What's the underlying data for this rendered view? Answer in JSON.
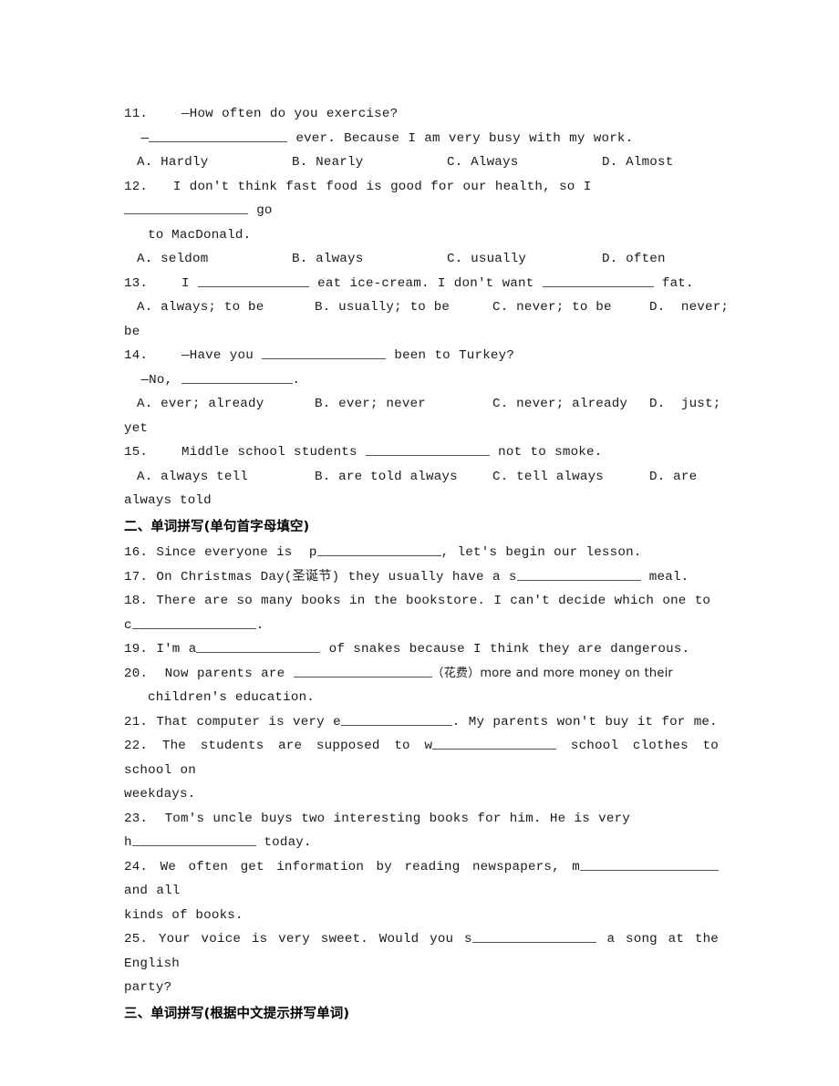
{
  "document": {
    "type": "english-exercise-worksheet",
    "page_background": "#ffffff",
    "text_color": "#1a1a1a"
  },
  "multiple_choice": {
    "questions": [
      {
        "number": "11.",
        "stem_line1": "—How often do you exercise?",
        "stem_line2_pre": "—",
        "stem_line2_post": " ever. Because I am very busy with my work.",
        "options": [
          "A. Hardly",
          "B. Nearly",
          "C. Always",
          "D. Almost"
        ]
      },
      {
        "number": "12.",
        "stem_line1_pre": "I don't think fast food is good for our health, so I ",
        "stem_line1_post": " go",
        "stem_line2": "to MacDonald.",
        "options": [
          "A. seldom",
          "B. always",
          "C. usually",
          "D. often"
        ]
      },
      {
        "number": "13.",
        "stem_pre": "I ",
        "stem_mid": " eat ice-cream. I don't want ",
        "stem_post": " fat.",
        "options": [
          "A. always; to be",
          "B. usually; to be",
          "C. never; to be",
          "D.  never;"
        ],
        "options_overflow": "be"
      },
      {
        "number": "14.",
        "stem_line1_pre": "—Have you ",
        "stem_line1_post": " been to Turkey?",
        "stem_line2_pre": "—No, ",
        "stem_line2_post": ".",
        "options": [
          "A. ever; already",
          "B. ever; never",
          "C. never; already",
          "D.  just;"
        ],
        "options_overflow": "yet"
      },
      {
        "number": "15.",
        "stem_pre": "Middle school students ",
        "stem_post": " not to smoke.",
        "options": [
          "A. always tell",
          "B. are told always",
          "C. tell always",
          "D. are"
        ],
        "options_overflow": "always told"
      }
    ]
  },
  "section_two": {
    "heading": "二、单词拼写(单句首字母填空)",
    "questions": [
      {
        "number": "16.",
        "pre": " Since everyone is  p",
        "post": ", let's begin our lesson."
      },
      {
        "number": "17.",
        "pre": " On Christmas Day(圣诞节) they usually have a s",
        "post": " meal."
      },
      {
        "number": "18.",
        "line1": "There are so many books in the bookstore. I can't decide which one to",
        "line2_pre": "c",
        "line2_post": "."
      },
      {
        "number": "19.",
        "pre": " I'm a",
        "post": " of snakes because I think they are dangerous."
      },
      {
        "number": "20.",
        "line1_pre": "Now parents are ",
        "line1_post": "（花费）more and more money on their",
        "line2": "children's education."
      },
      {
        "number": "21.",
        "pre": " That computer is very e",
        "post": ". My parents won't buy it for me."
      },
      {
        "number": "22.",
        "pre": " The students are supposed to w",
        "post": " school clothes to school on",
        "line2": "weekdays."
      },
      {
        "number": "23.",
        "line1": "Tom's uncle buys two interesting books for him. He is very",
        "line2_pre": "h",
        "line2_post": " today."
      },
      {
        "number": "24.",
        "pre": " We often get information by reading newspapers, m",
        "post": " and all",
        "line2": "kinds of books."
      },
      {
        "number": "25.",
        "pre": " Your voice is very sweet. Would you s",
        "post": " a song at the English",
        "line2": "party?"
      }
    ]
  },
  "section_three": {
    "heading": "三、单词拼写(根据中文提示拼写单词)"
  }
}
